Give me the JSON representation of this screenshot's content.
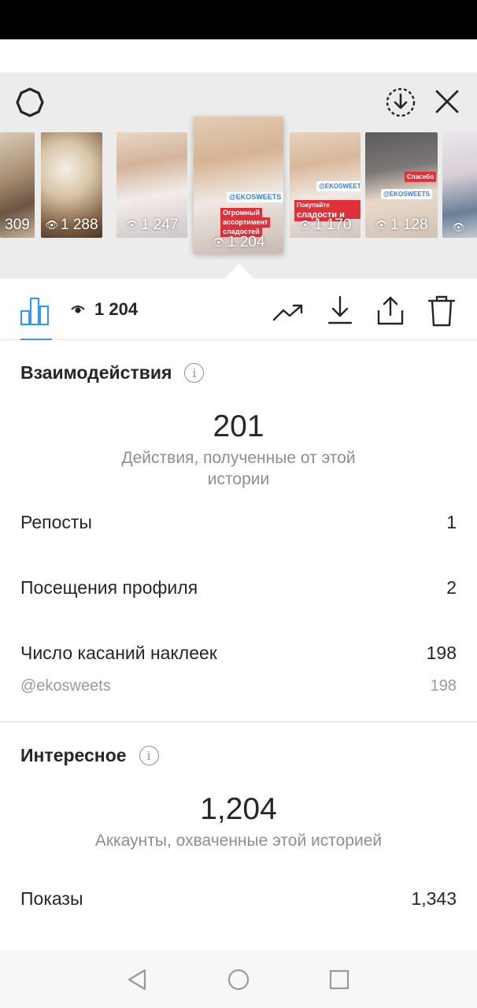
{
  "header": {
    "thumbnails": [
      {
        "count": "309",
        "sticker_lines": []
      },
      {
        "count": "1 288",
        "sticker_lines": []
      },
      {
        "count": "1 247",
        "sticker_lines": []
      },
      {
        "count": "1 204",
        "sticker_lines": [
          "@EKOSWEETS",
          "Огромный",
          "ассортимент",
          "сладостей"
        ],
        "active": true
      },
      {
        "count": "1 170",
        "sticker_lines": [
          "@EKOSWEETS",
          "Покупайте полезные",
          "сладости и"
        ]
      },
      {
        "count": "1 128",
        "sticker_lines": [
          "@EKOSWEETS",
          "Спасибо"
        ]
      },
      {
        "count": "",
        "sticker_lines": []
      }
    ],
    "active_count_icon": "eye-icon"
  },
  "toolbar": {
    "views_count": "1 204"
  },
  "interactions": {
    "title": "Взаимодействия",
    "total": "201",
    "caption": "Действия, полученные от этой истории",
    "rows": [
      {
        "label": "Репосты",
        "value": "1"
      },
      {
        "label": "Посещения профиля",
        "value": "2"
      },
      {
        "label": "Число касаний наклеек",
        "value": "198"
      }
    ],
    "sub_row": {
      "label": "@ekosweets",
      "value": "198"
    }
  },
  "discovery": {
    "title": "Интересное",
    "total": "1,204",
    "caption": "Аккаунты, охваченные этой историей",
    "rows": [
      {
        "label": "Показы",
        "value": "1,343"
      }
    ]
  },
  "colors": {
    "accent": "#3897f0",
    "text": "#262626",
    "secondary": "#8e8e8e",
    "header_bg": "#ececec"
  }
}
